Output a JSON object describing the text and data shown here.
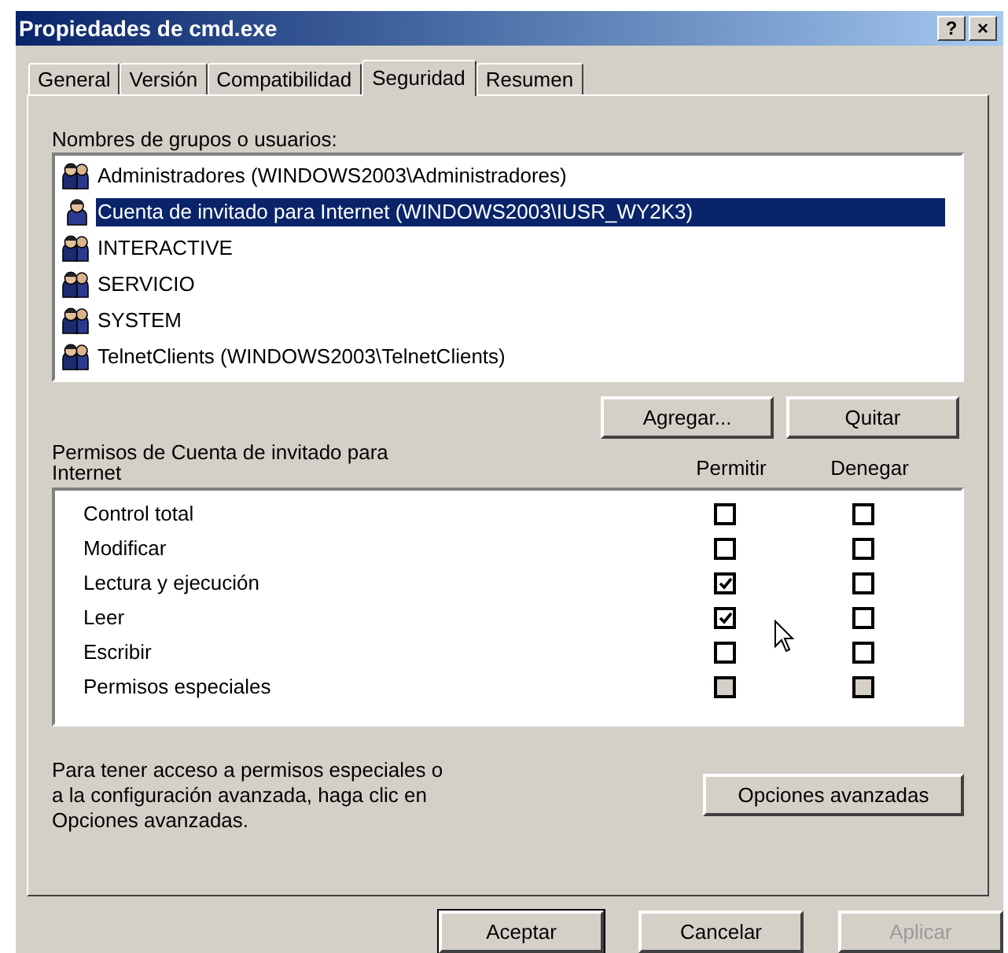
{
  "window": {
    "title": "Propiedades de cmd.exe",
    "controls": [
      "?",
      "×"
    ]
  },
  "tabs": [
    {
      "label": "General",
      "selected": false
    },
    {
      "label": "Versión",
      "selected": false
    },
    {
      "label": "Compatibilidad",
      "selected": false
    },
    {
      "label": "Seguridad",
      "selected": true
    },
    {
      "label": "Resumen",
      "selected": false
    }
  ],
  "users": {
    "label": "Nombres de grupos o usuarios:",
    "items": [
      {
        "name": "Administradores (WINDOWS2003\\Administradores)",
        "kind": "group",
        "selected": false
      },
      {
        "name": "Cuenta de invitado para Internet (WINDOWS2003\\IUSR_WY2K3)",
        "kind": "user",
        "selected": true
      },
      {
        "name": "INTERACTIVE",
        "kind": "group",
        "selected": false
      },
      {
        "name": "SERVICIO",
        "kind": "group",
        "selected": false
      },
      {
        "name": "SYSTEM",
        "kind": "group",
        "selected": false
      },
      {
        "name": "TelnetClients (WINDOWS2003\\TelnetClients)",
        "kind": "group",
        "selected": false
      }
    ],
    "buttons": [
      "Agregar...",
      "Quitar"
    ]
  },
  "permissions": {
    "label": "Permisos de Cuenta de invitado para Internet",
    "columns": [
      "Permitir",
      "Denegar"
    ],
    "rows": [
      {
        "name": "Control total",
        "allow": false,
        "deny": false,
        "disabled": false
      },
      {
        "name": "Modificar",
        "allow": false,
        "deny": false,
        "disabled": false
      },
      {
        "name": "Lectura y ejecución",
        "allow": true,
        "deny": false,
        "disabled": false
      },
      {
        "name": "Leer",
        "allow": true,
        "deny": false,
        "disabled": false
      },
      {
        "name": "Escribir",
        "allow": false,
        "deny": false,
        "disabled": false
      },
      {
        "name": "Permisos especiales",
        "allow": false,
        "deny": false,
        "disabled": true
      }
    ]
  },
  "advanced": {
    "text": "Para tener acceso a permisos especiales o a la configuración avanzada, haga clic en Opciones avanzadas.",
    "button": "Opciones avanzadas"
  },
  "footer_buttons": [
    {
      "label": "Aceptar",
      "default": true,
      "disabled": false
    },
    {
      "label": "Cancelar",
      "default": false,
      "disabled": false
    },
    {
      "label": "Aplicar",
      "default": false,
      "disabled": true
    }
  ]
}
